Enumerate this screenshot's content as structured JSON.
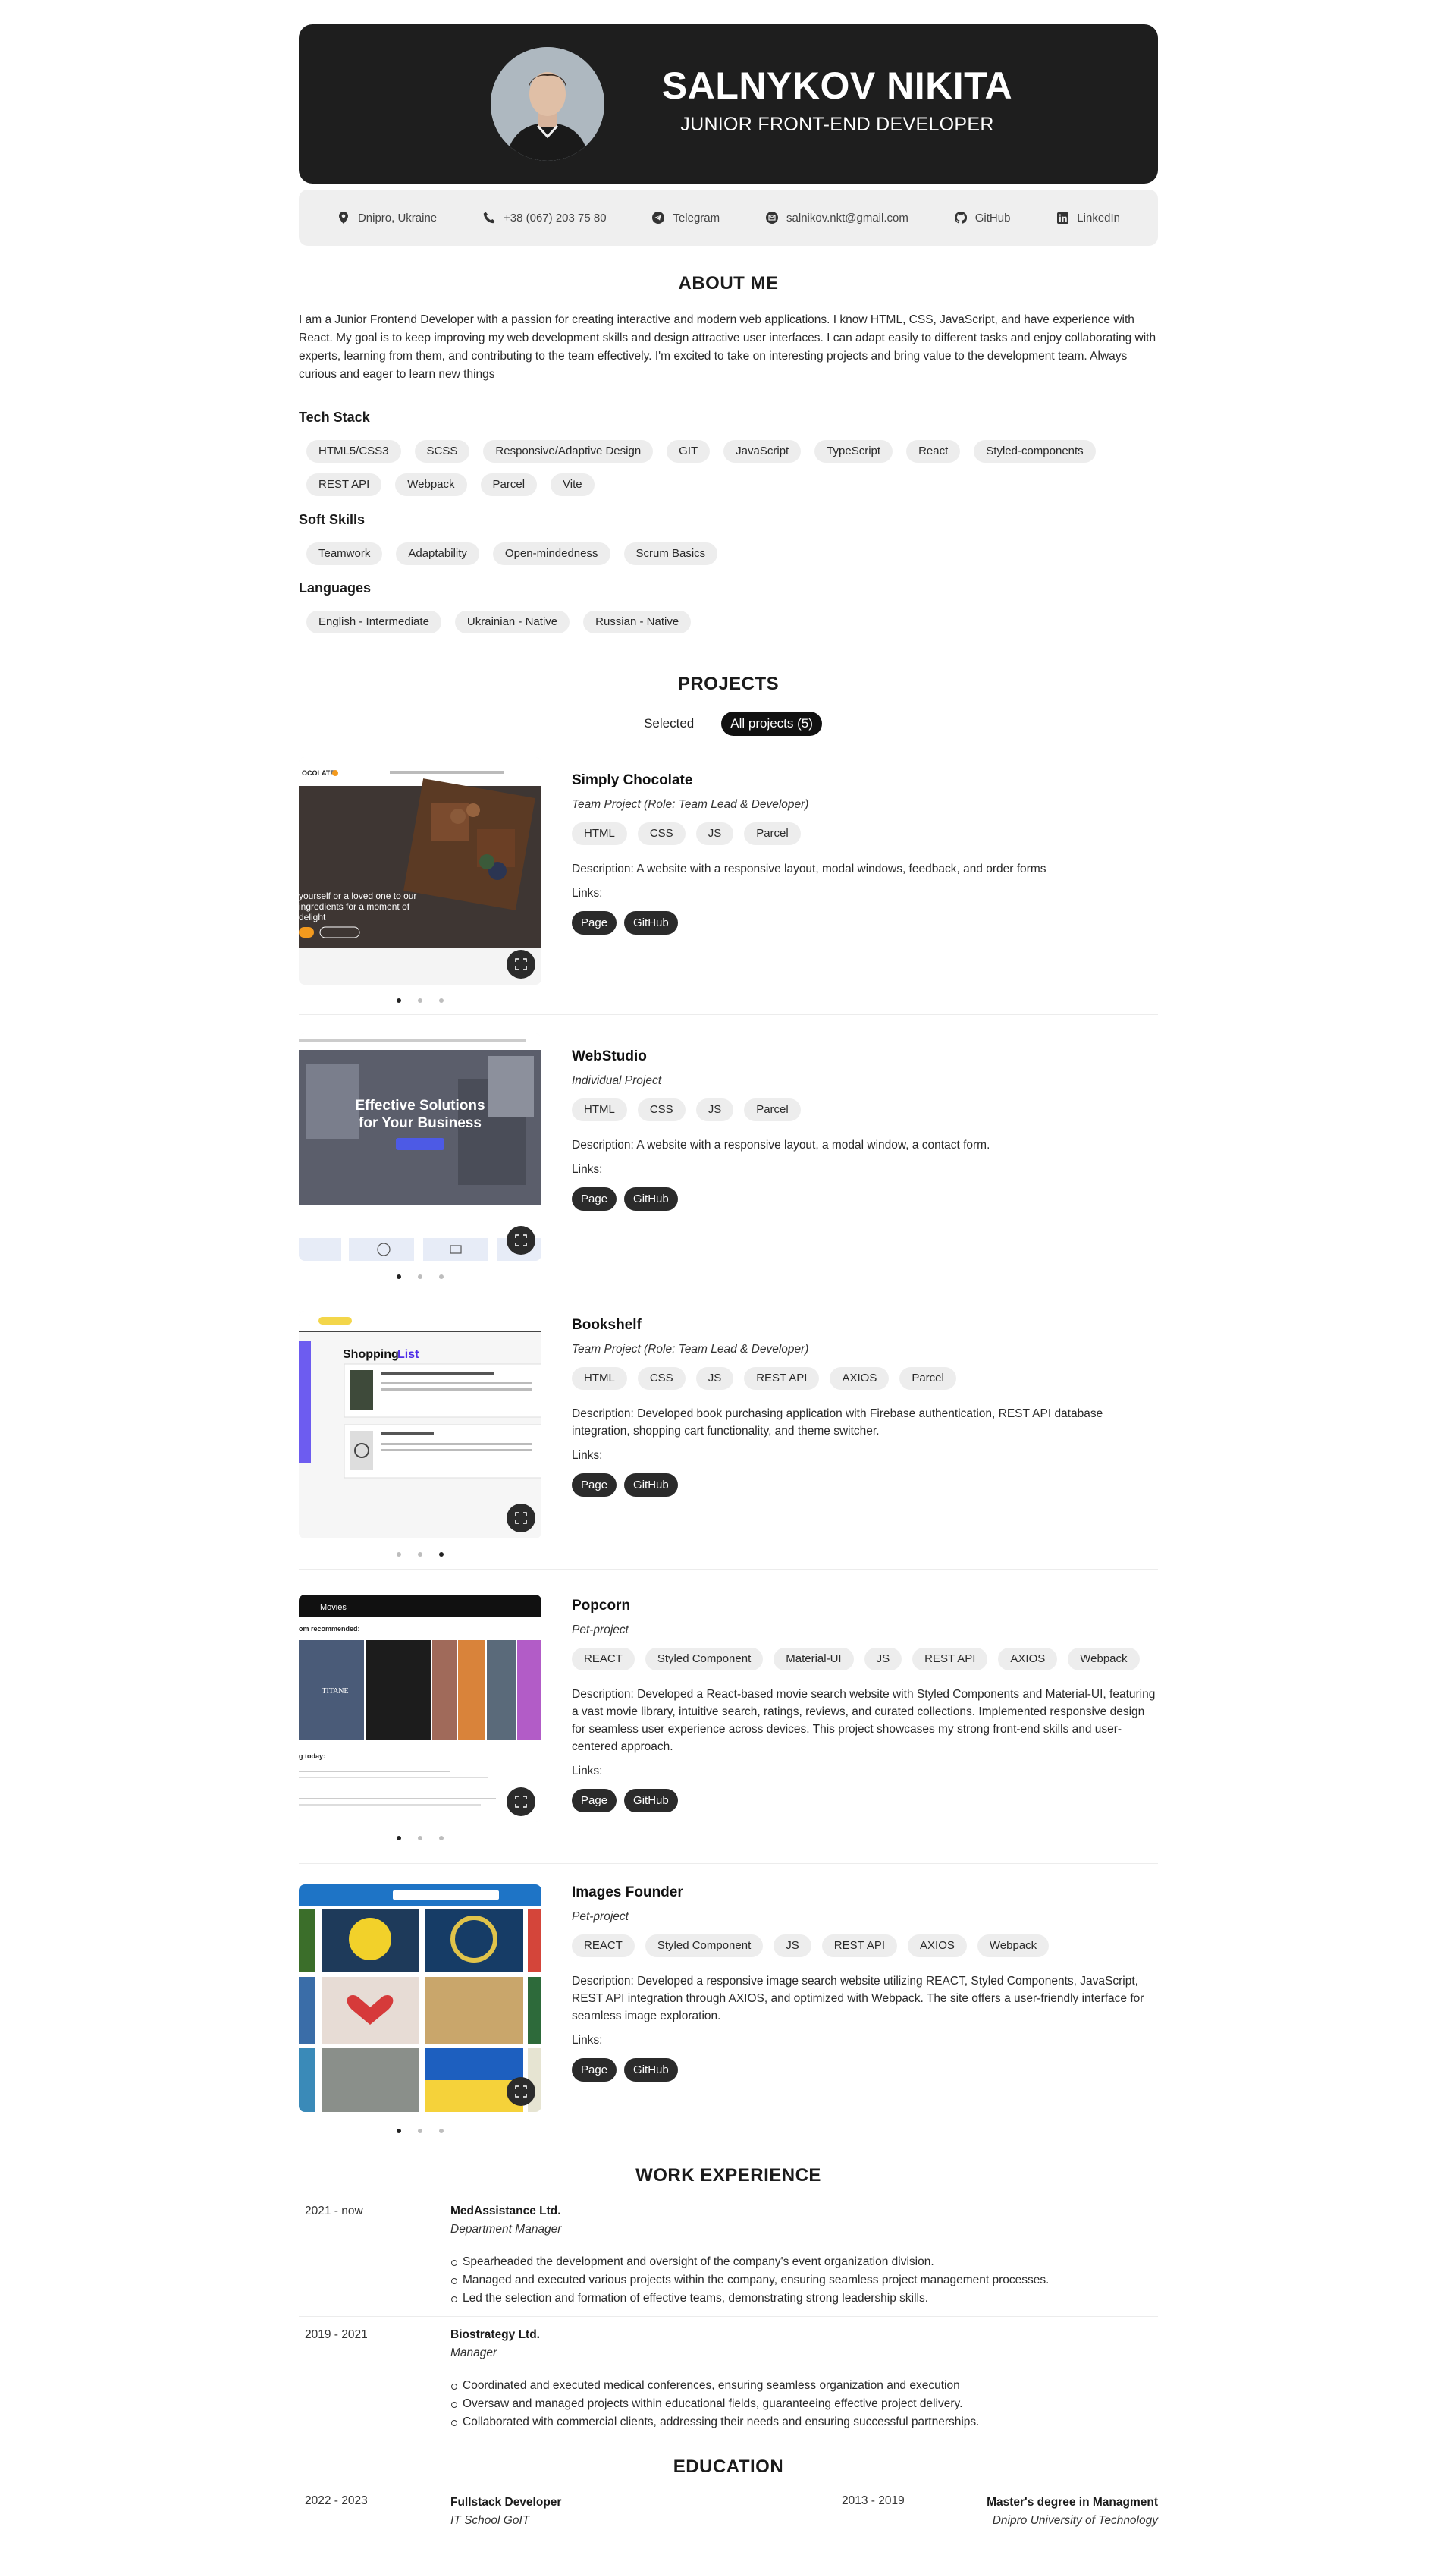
{
  "header": {
    "name": "SALNYKOV NIKITA",
    "role": "JUNIOR FRONT-END DEVELOPER"
  },
  "contacts": [
    {
      "icon": "location-pin-icon",
      "label": "Dnipro, Ukraine"
    },
    {
      "icon": "phone-icon",
      "label": "+38 (067) 203 75 80"
    },
    {
      "icon": "telegram-icon",
      "label": "Telegram"
    },
    {
      "icon": "email-icon",
      "label": "salnikov.nkt@gmail.com"
    },
    {
      "icon": "github-icon",
      "label": "GitHub"
    },
    {
      "icon": "linkedin-icon",
      "label": "LinkedIn"
    }
  ],
  "about": {
    "title": "ABOUT ME",
    "text": "I am a Junior Frontend Developer with a passion for creating interactive and modern web applications. I know HTML, CSS, JavaScript, and have experience with React. My goal is to keep improving my web development skills and design attractive user interfaces. I can adapt easily to different tasks and enjoy collaborating with experts, learning from them, and contributing to the team effectively. I'm excited to take on interesting projects and bring value to the development team. Always curious and eager to learn new things"
  },
  "tech_stack": {
    "title": "Tech Stack",
    "items": [
      "HTML5/CSS3",
      "SCSS",
      "Responsive/Adaptive Design",
      "GIT",
      "JavaScript",
      "TypeScript",
      "React",
      "Styled-components",
      "REST API",
      "Webpack",
      "Parcel",
      "Vite"
    ]
  },
  "soft_skills": {
    "title": "Soft Skills",
    "items": [
      "Teamwork",
      "Adaptability",
      "Open-mindedness",
      "Scrum Basics"
    ]
  },
  "languages": {
    "title": "Languages",
    "items": [
      "English - Intermediate",
      "Ukrainian - Native",
      "Russian - Native"
    ]
  },
  "projects": {
    "title": "PROJECTS",
    "toggle_selected": "Selected",
    "toggle_all": "All projects (5)",
    "links_label": "Links:",
    "page_label": "Page",
    "github_label": "GitHub",
    "items": [
      {
        "title": "Simply Chocolate",
        "role": "Team Project (Role: Team Lead & Developer)",
        "tags": [
          "HTML",
          "CSS",
          "JS",
          "Parcel"
        ],
        "description": "Description: A website with a responsive layout, modal windows, feedback, and order forms",
        "active_slide": 1,
        "thumb_text": "yourself or a loved one to our ingredients for a moment of delight"
      },
      {
        "title": "WebStudio",
        "role": "Individual Project",
        "tags": [
          "HTML",
          "CSS",
          "JS",
          "Parcel"
        ],
        "description": "Description: A website with a responsive layout, a modal window, a contact form.",
        "active_slide": 2,
        "thumb_text": "Effective Solutions for Your Business"
      },
      {
        "title": "Bookshelf",
        "role": "Team Project (Role: Team Lead & Developer)",
        "tags": [
          "HTML",
          "CSS",
          "JS",
          "REST API",
          "AXIOS",
          "Parcel"
        ],
        "description": "Description: Developed book purchasing application with Firebase authentication, REST API database integration, shopping cart functionality, and theme switcher.",
        "active_slide": 3,
        "thumb_text": "Shopping List"
      },
      {
        "title": "Popcorn",
        "role": "Pet-project",
        "tags": [
          "REACT",
          "Styled Component",
          "Material-UI",
          "JS",
          "REST API",
          "AXIOS",
          "Webpack"
        ],
        "description": "Description: Developed a React-based movie search website with Styled Components and Material-UI, featuring a vast movie library, intuitive search, ratings, reviews, and curated collections. Implemented responsive design for seamless user experience across devices. This project showcases my strong front-end skills and user-centered approach.",
        "active_slide": 1,
        "thumb_text": "Movies"
      },
      {
        "title": "Images Founder",
        "role": "Pet-project",
        "tags": [
          "REACT",
          "Styled Component",
          "JS",
          "REST API",
          "AXIOS",
          "Webpack"
        ],
        "description": "Description: Developed a responsive image search website utilizing REACT, Styled Components, JavaScript, REST API integration through AXIOS, and optimized with Webpack. The site offers a user-friendly interface for seamless image exploration.",
        "active_slide": 1,
        "thumb_text": ""
      }
    ]
  },
  "work": {
    "title": "WORK EXPERIENCE",
    "jobs": [
      {
        "date": "2021 - now",
        "company": "MedAssistance Ltd.",
        "position": "Department Manager",
        "bullets": [
          "Spearheaded the development and oversight of the company's event organization division.",
          "Managed and executed various projects within the company, ensuring seamless project management processes.",
          "Led the selection and formation of effective teams, demonstrating strong leadership skills."
        ]
      },
      {
        "date": "2019 - 2021",
        "company": "Biostrategy Ltd.",
        "position": "Manager",
        "bullets": [
          "Coordinated and executed medical conferences, ensuring seamless organization and execution",
          "Oversaw and managed projects within educational fields, guaranteeing effective project delivery.",
          "Collaborated with commercial clients, addressing their needs and ensuring successful partnerships."
        ]
      }
    ]
  },
  "education": {
    "title": "EDUCATION",
    "items": [
      {
        "date": "2022 - 2023",
        "title": "Fullstack Developer",
        "school": "IT School GoIT"
      },
      {
        "date": "2013 - 2019",
        "title": "Master's degree in Managment",
        "school": "Dnipro University of Technology"
      }
    ]
  },
  "colors": {
    "header_bg": "#1e1e1e",
    "chip_bg": "#ededed",
    "button_bg": "#2b2b2b",
    "contacts_bg": "#efefef"
  }
}
